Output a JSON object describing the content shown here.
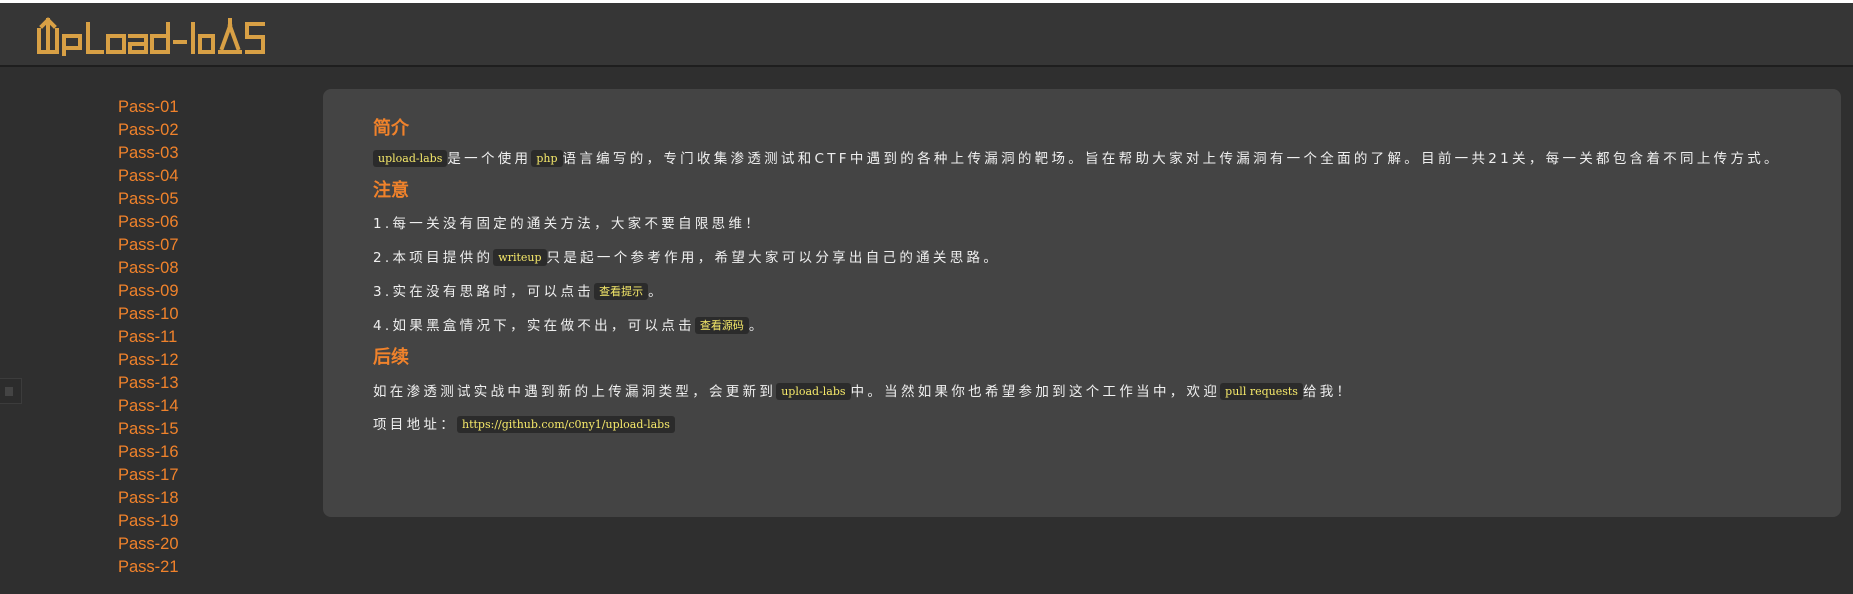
{
  "header": {
    "logo_text": "upload-labs",
    "brand_color": "#d8a045"
  },
  "sidebar": {
    "items": [
      "Pass-01",
      "Pass-02",
      "Pass-03",
      "Pass-04",
      "Pass-05",
      "Pass-06",
      "Pass-07",
      "Pass-08",
      "Pass-09",
      "Pass-10",
      "Pass-11",
      "Pass-12",
      "Pass-13",
      "Pass-14",
      "Pass-15",
      "Pass-16",
      "Pass-17",
      "Pass-18",
      "Pass-19",
      "Pass-20",
      "Pass-21"
    ]
  },
  "main": {
    "intro": {
      "title": "简介",
      "code1": "upload-labs",
      "text1": "是一个使用",
      "code2": "php",
      "text2": "语言编写的，专门收集渗透测试和CTF中遇到的各种上传漏洞的靶场。旨在帮助大家对上传漏洞有一个全面的了解。目前一共21关，每一关都包含着不同上传方式。"
    },
    "notes": {
      "title": "注意",
      "item1": "1.每一关没有固定的通关方法，大家不要自限思维！",
      "item2_pre": "2.本项目提供的",
      "item2_code": "writeup",
      "item2_post": "只是起一个参考作用，希望大家可以分享出自己的通关思路。",
      "item3_pre": "3.实在没有思路时，可以点击",
      "item3_link": "查看提示",
      "item3_post": "。",
      "item4_pre": "4.如果黑盒情况下，实在做不出，可以点击",
      "item4_link": "查看源码",
      "item4_post": "。"
    },
    "followup": {
      "title": "后续",
      "text_pre": "如在渗透测试实战中遇到新的上传漏洞类型，会更新到",
      "code1": "upload-labs",
      "text_mid": "中。当然如果你也希望参加到这个工作当中，欢迎",
      "code2": "pull requests",
      "text_post": "给我！",
      "addr_label": "项目地址：",
      "addr_url": "https://github.com/c0ny1/upload-labs"
    }
  },
  "colors": {
    "accent": "#f0822b",
    "code_text": "#f6e96a",
    "panel_bg": "#444444",
    "page_bg": "#2f2f2f"
  }
}
